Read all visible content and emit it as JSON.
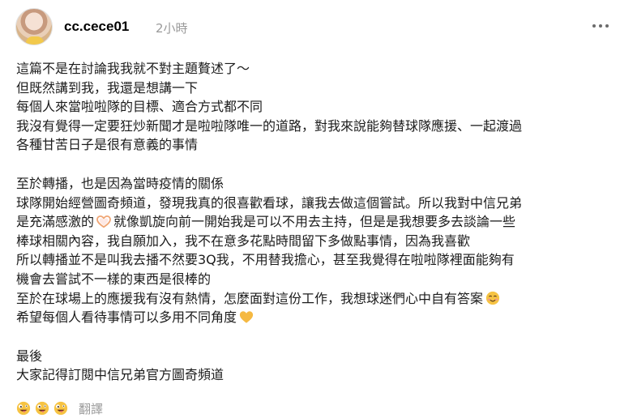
{
  "post": {
    "author": "cc.cece01",
    "time": "2小時",
    "lines_p1": [
      "這篇不是在討論我我就不對主題贅述了～",
      "但既然講到我，我還是想講一下",
      "每個人來當啦啦隊的目標、適合方式都不同",
      "我沒有覺得一定要狂炒新聞才是啦啦隊唯一的道路，對我來說能夠替球隊應援、一起渡過",
      "各種甘苦日子是很有意義的事情"
    ],
    "lines_p2": [
      "至於轉播，也是因為當時疫情的關係",
      "球隊開始經營圖奇頻道，發現我真的很喜歡看球，讓我去做這個嘗試。所以我對中信兄弟",
      "是充滿感激的",
      "就像凱旋向前一開始我是可以不用去主持，但是是我想要多去談論一些",
      "棒球相關內容，我自願加入，我不在意多花點時間留下多做點事情，因為我喜歡",
      "所以轉播並不是叫我去播不然要3Q我，不用替我擔心，甚至我覺得在啦啦隊裡面能夠有",
      "機會去嘗試不一樣的東西是很棒的",
      "至於在球場上的應援我有沒有熱情，怎麼面對這份工作，我想球迷們心中自有答案",
      "希望每個人看待事情可以多用不同角度"
    ],
    "lines_p3": [
      "最後",
      "大家記得訂閱中信兄弟官方圖奇頻道"
    ],
    "translate_label": "翻譯"
  },
  "icons": {
    "more": "more-horizontal-icon",
    "inline_1": "heart-hands-emoji",
    "inline_2": "smiling-face-emoji",
    "inline_3": "yellow-heart-emoji",
    "footer": "zany-face-emoji"
  },
  "colors": {
    "text": "#1c1c1c",
    "muted": "#9a9a9a",
    "emoji_yellow": "#f6c343",
    "heart_yellow": "#f5b942"
  }
}
